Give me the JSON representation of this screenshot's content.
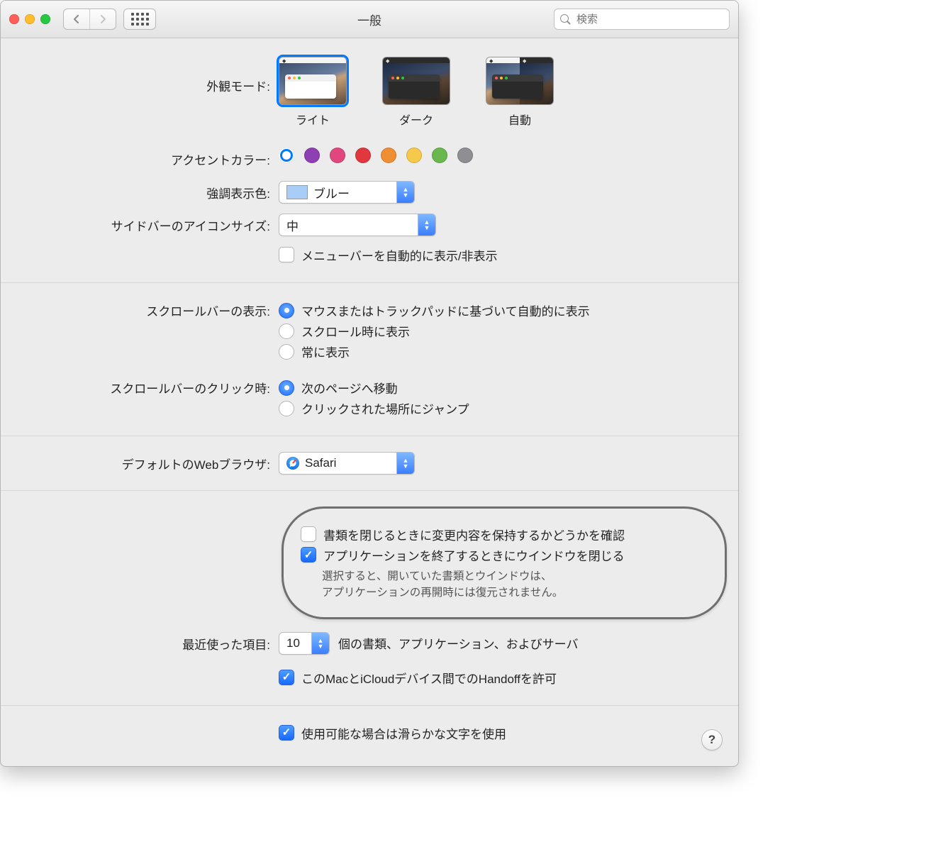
{
  "window": {
    "title": "一般"
  },
  "search": {
    "placeholder": "検索"
  },
  "appearance": {
    "label": "外観モード:",
    "options": {
      "light": "ライト",
      "dark": "ダーク",
      "auto": "自動"
    },
    "selected": "light"
  },
  "accent": {
    "label": "アクセントカラー:",
    "colors": [
      {
        "name": "blue",
        "hex": "#007aff",
        "selected": true
      },
      {
        "name": "purple",
        "hex": "#8d3fb3",
        "selected": false
      },
      {
        "name": "pink",
        "hex": "#e1477e",
        "selected": false
      },
      {
        "name": "red",
        "hex": "#e0383e",
        "selected": false
      },
      {
        "name": "orange",
        "hex": "#ef8e34",
        "selected": false
      },
      {
        "name": "yellow",
        "hex": "#f7c94b",
        "selected": false
      },
      {
        "name": "green",
        "hex": "#68b84e",
        "selected": false
      },
      {
        "name": "gray",
        "hex": "#8e8e93",
        "selected": false
      }
    ]
  },
  "highlight": {
    "label": "強調表示色:",
    "value": "ブルー"
  },
  "sidebarIcon": {
    "label": "サイドバーのアイコンサイズ:",
    "value": "中"
  },
  "menubarAuto": {
    "label": "メニューバーを自動的に表示/非表示",
    "checked": false
  },
  "scrollShow": {
    "label": "スクロールバーの表示:",
    "options": {
      "auto": "マウスまたはトラックパッドに基づいて自動的に表示",
      "scroll": "スクロール時に表示",
      "always": "常に表示"
    },
    "selected": "auto"
  },
  "scrollClick": {
    "label": "スクロールバーのクリック時:",
    "options": {
      "page": "次のページへ移動",
      "jump": "クリックされた場所にジャンプ"
    },
    "selected": "page"
  },
  "browser": {
    "label": "デフォルトのWebブラウザ:",
    "value": "Safari"
  },
  "askOnClose": {
    "label": "書類を閉じるときに変更内容を保持するかどうかを確認",
    "checked": false
  },
  "closeOnQuit": {
    "label": "アプリケーションを終了するときにウインドウを閉じる",
    "checked": true,
    "note1": "選択すると、開いていた書類とウインドウは、",
    "note2": "アプリケーションの再開時には復元されません。"
  },
  "recent": {
    "label": "最近使った項目:",
    "value": "10",
    "suffix": "個の書類、アプリケーション、およびサーバ"
  },
  "handoff": {
    "label": "このMacとiCloudデバイス間でのHandoffを許可",
    "checked": true
  },
  "smoothing": {
    "label": "使用可能な場合は滑らかな文字を使用",
    "checked": true
  },
  "help": {
    "label": "?"
  }
}
